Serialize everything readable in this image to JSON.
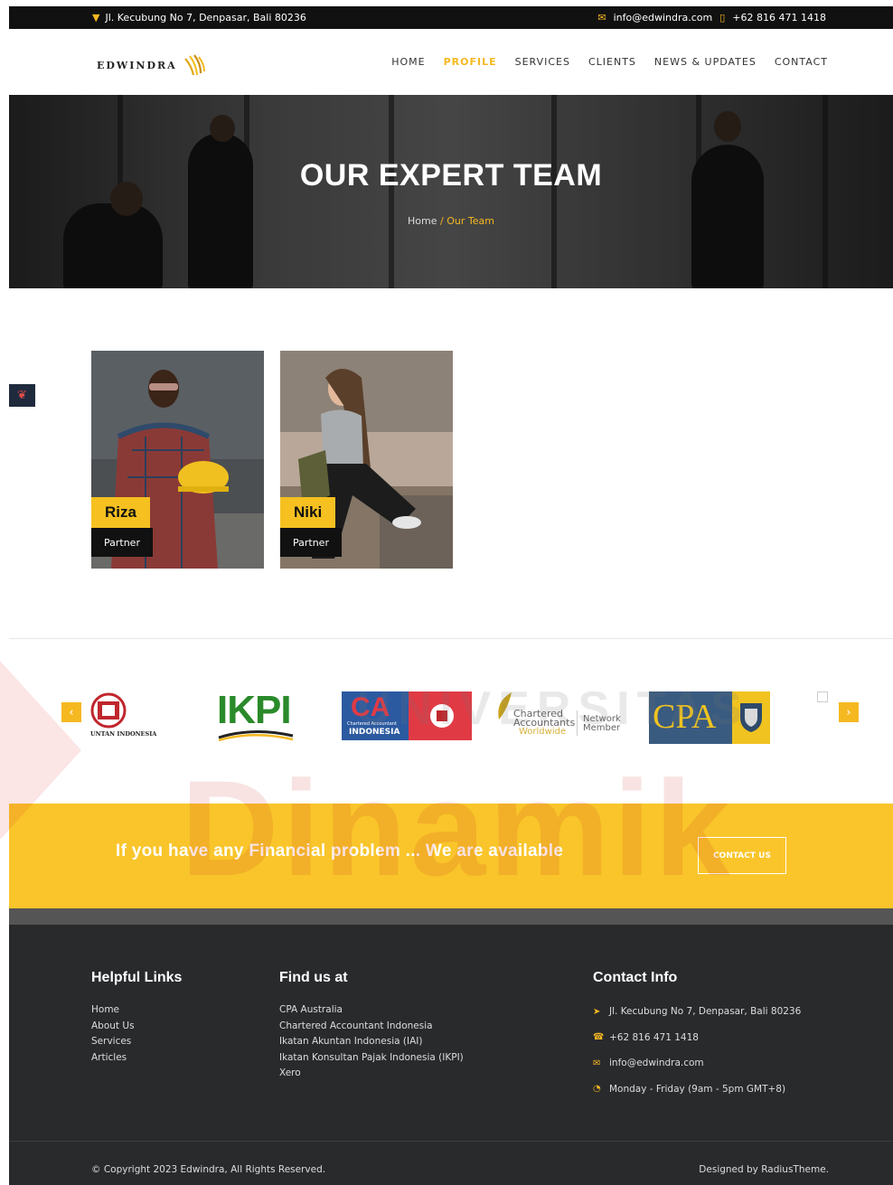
{
  "topbar": {
    "address": "Jl. Kecubung No 7, Denpasar, Bali 80236",
    "email": "info@edwindra.com",
    "phone": "+62 816 471 1418"
  },
  "brand": {
    "name": "EDWINDRA"
  },
  "nav": {
    "items": [
      "HOME",
      "PROFILE",
      "SERVICES",
      "CLIENTS",
      "NEWS & UPDATES",
      "CONTACT"
    ],
    "active": "PROFILE"
  },
  "hero": {
    "title": "OUR EXPERT TEAM",
    "breadcrumb_home": "Home",
    "breadcrumb_sep": "/",
    "breadcrumb_current": "Our Team"
  },
  "team": [
    {
      "name": "Riza",
      "role": "Partner"
    },
    {
      "name": "Niki",
      "role": "Partner"
    }
  ],
  "partners": {
    "iai_name": "IAI",
    "iai_caption": "UNTAN INDONESIA",
    "ikpi_name": "IKPI",
    "ca_name": "CA",
    "ca_caption": "INDONESIA",
    "ca_sub": "Chartered Accountant",
    "caw_line1": "Chartered",
    "caw_line2": "Accountants",
    "caw_line3": "Worldwide",
    "caw_network1": "Network",
    "caw_network2": "Member",
    "cpa_name": "CPA"
  },
  "watermark": {
    "top": "UNIVERSITAS",
    "main": "Dinamik"
  },
  "cta": {
    "text": "If you have any Financial problem ... We are available",
    "button": "CONTACT US"
  },
  "footer": {
    "helpful_title": "Helpful Links",
    "helpful_links": [
      "Home",
      "About Us",
      "Services",
      "Articles"
    ],
    "find_title": "Find us at",
    "find_links": [
      "CPA Australia",
      "Chartered Accountant Indonesia",
      "Ikatan Akuntan Indonesia (IAI)",
      "Ikatan Konsultan Pajak Indonesia (IKPI)",
      "Xero"
    ],
    "contact_title": "Contact Info",
    "contact_address": "Jl. Kecubung No 7, Denpasar, Bali 80236",
    "contact_phone": "+62 816 471 1418",
    "contact_email": "info@edwindra.com",
    "contact_hours": "Monday - Friday (9am - 5pm GMT+8)",
    "copyright": "© Copyright 2023 Edwindra, All Rights Reserved.",
    "designed_by": "Designed by RadiusTheme."
  },
  "colors": {
    "accent": "#f5b820",
    "dark": "#292a2c",
    "cta_bg": "#f9c52a"
  }
}
